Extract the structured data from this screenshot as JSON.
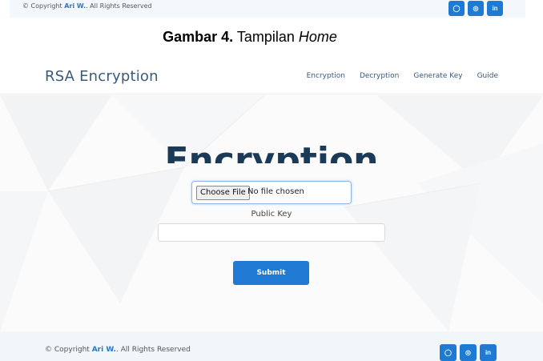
{
  "top_footer": {
    "copyright_prefix": "© Copyright",
    "author": "Ari W.",
    "copyright_suffix": "All Rights Reserved",
    "social": [
      {
        "icon": "github-icon",
        "glyph": "◯"
      },
      {
        "icon": "instagram-icon",
        "glyph": "◎"
      },
      {
        "icon": "linkedin-icon",
        "glyph": "in"
      }
    ]
  },
  "caption": {
    "number": "Gambar 4.",
    "text": "Tampilan",
    "emphasis": "Home"
  },
  "app": {
    "brand": "RSA Encryption",
    "nav": [
      "Encryption",
      "Decryption",
      "Generate Key",
      "Guide"
    ],
    "page_title": "Encryption",
    "file_button": "Choose File",
    "file_status": "No file chosen",
    "public_key_label": "Public Key",
    "public_key_value": "",
    "submit_label": "Submit",
    "accent_color": "#1e7ad3"
  },
  "footer": {
    "copyright_prefix": "© Copyright",
    "author": "Ari W.",
    "copyright_suffix": "All Rights Reserved",
    "social": [
      {
        "icon": "github-icon",
        "glyph": "◯"
      },
      {
        "icon": "instagram-icon",
        "glyph": "◎"
      },
      {
        "icon": "linkedin-icon",
        "glyph": "in"
      }
    ]
  }
}
